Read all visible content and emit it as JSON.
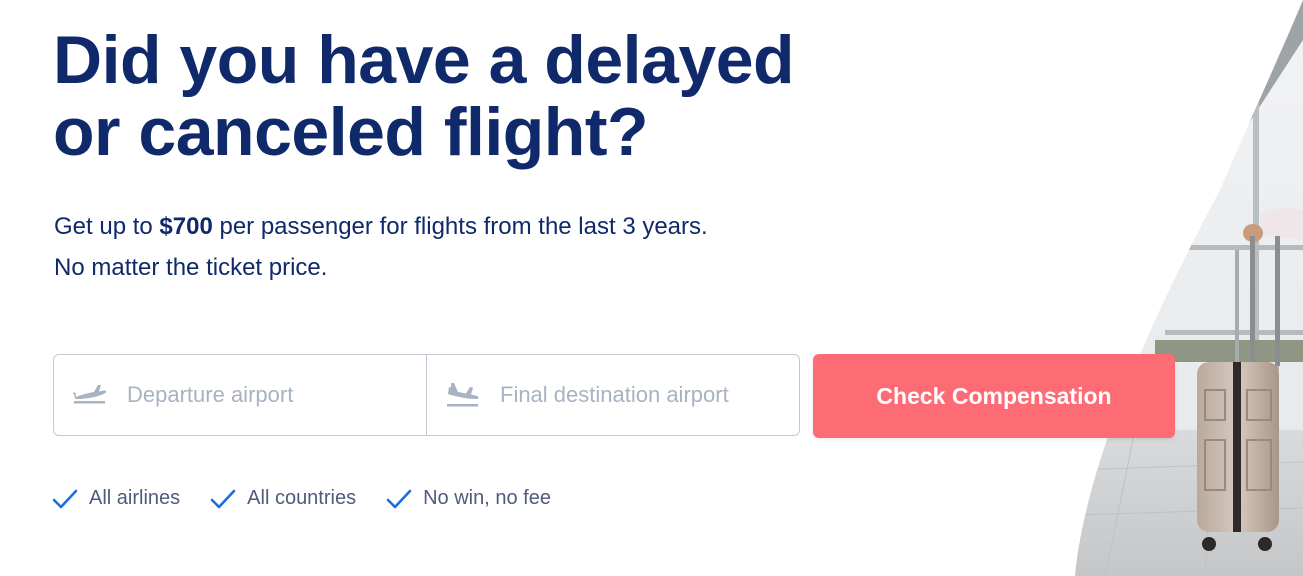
{
  "hero": {
    "title_line1": "Did you have a delayed",
    "title_line2": "or canceled flight?",
    "sub_prefix": "Get up to ",
    "sub_amount": "$700",
    "sub_suffix": " per passenger for flights from the last 3 years.",
    "sub_line2": "No matter the ticket price."
  },
  "form": {
    "departure": {
      "icon": "plane-takeoff-icon",
      "placeholder": "Departure airport",
      "value": ""
    },
    "destination": {
      "icon": "plane-landing-icon",
      "placeholder": "Final destination airport",
      "value": ""
    },
    "submit_label": "Check Compensation"
  },
  "benefits": [
    {
      "icon": "checkmark-icon",
      "label": "All airlines"
    },
    {
      "icon": "checkmark-icon",
      "label": "All countries"
    },
    {
      "icon": "checkmark-icon",
      "label": "No win, no fee"
    }
  ],
  "colors": {
    "headline": "#10296b",
    "accent_button": "#fd6c75",
    "check_icon": "#1a6fe0",
    "placeholder": "#a7b2c3",
    "border": "#c3c9d2"
  },
  "photo": {
    "icon": "airport-traveler-suitcase-photo"
  }
}
